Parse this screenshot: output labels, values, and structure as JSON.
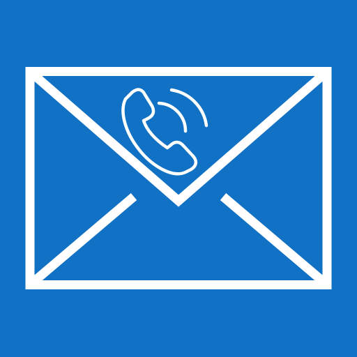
{
  "icon": {
    "semantic": "mail-phone-icon",
    "envelope": "envelope-icon",
    "handset": "phone-icon",
    "waves": "call-waves-icon"
  },
  "colors": {
    "background": "#1171c4",
    "foreground": "#ffffff"
  }
}
